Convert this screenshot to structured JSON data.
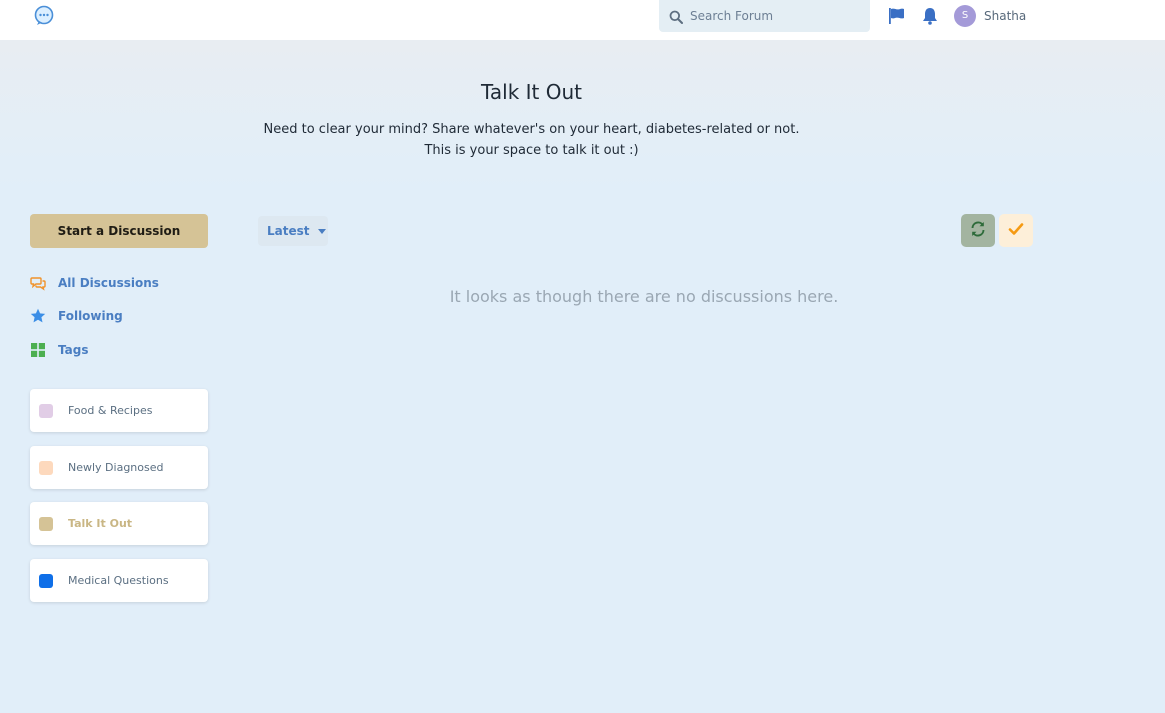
{
  "header": {
    "search_placeholder": "Search Forum",
    "user": {
      "initial": "S",
      "name": "Shatha"
    }
  },
  "hero": {
    "title": "Talk It Out",
    "description": "Need to clear your mind? Share whatever's on your heart, diabetes-related or not. This is your space to talk it out :)"
  },
  "sidebar": {
    "start_button_label": "Start a Discussion",
    "nav": [
      {
        "label": "All Discussions",
        "icon": "comments-icon"
      },
      {
        "label": "Following",
        "icon": "star-icon"
      },
      {
        "label": "Tags",
        "icon": "grid-icon"
      }
    ],
    "tags": [
      {
        "label": "Food & Recipes",
        "color": "#e1cde6",
        "active": false
      },
      {
        "label": "Newly Diagnosed",
        "color": "#fdd9bd",
        "active": false
      },
      {
        "label": "Talk It Out",
        "color": "#d5c396",
        "active": true
      },
      {
        "label": "Medical Questions",
        "color": "#0f6fe8",
        "active": false
      }
    ]
  },
  "toolbar": {
    "sort_label": "Latest"
  },
  "main": {
    "empty_message": "It looks as though there are no discussions here."
  },
  "colors": {
    "accent": "#4a7ec2",
    "primary_button": "#d5c396",
    "background": "#e1eef9"
  }
}
